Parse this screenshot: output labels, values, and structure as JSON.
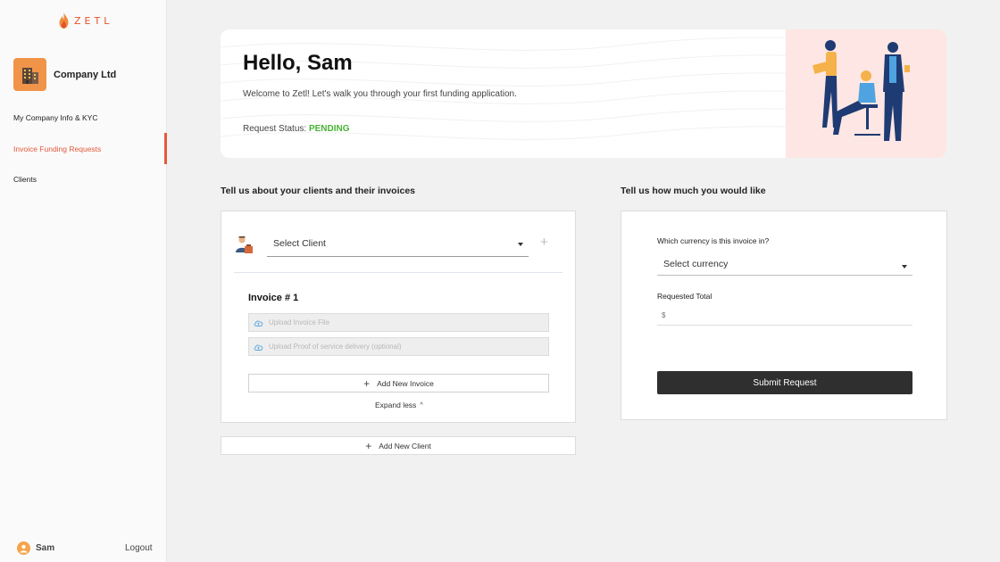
{
  "brand": {
    "logo_text": "ZETL",
    "accent": "#e45a3b"
  },
  "sidebar": {
    "company_name": "Company Ltd",
    "items": [
      {
        "label": "My Company Info & KYC",
        "active": false
      },
      {
        "label": "Invoice Funding Requests",
        "active": true
      },
      {
        "label": "Clients",
        "active": false
      }
    ],
    "user_name": "Sam",
    "logout_label": "Logout"
  },
  "banner": {
    "greeting": "Hello, Sam",
    "welcome": "Welcome to Zetl! Let's walk you through your first funding application.",
    "status_label": "Request Status: ",
    "status_value": "PENDING",
    "status_color": "#49b234"
  },
  "clients_section": {
    "title": "Tell us about your clients and their invoices",
    "select_client": "Select Client",
    "invoice_title": "Invoice # 1",
    "upload_invoice": "Upload Invoice File",
    "upload_proof": "Upload Proof of service delivery (optional)",
    "add_invoice": "Add New Invoice",
    "expand_less": "Expand less",
    "add_client": "Add New Client"
  },
  "funding_section": {
    "title": "Tell us how much you would like",
    "currency_question": "Which currency is this invoice in?",
    "select_currency": "Select currency",
    "requested_total_label": "Requested Total",
    "amount_placeholder": "$",
    "submit": "Submit Request"
  }
}
